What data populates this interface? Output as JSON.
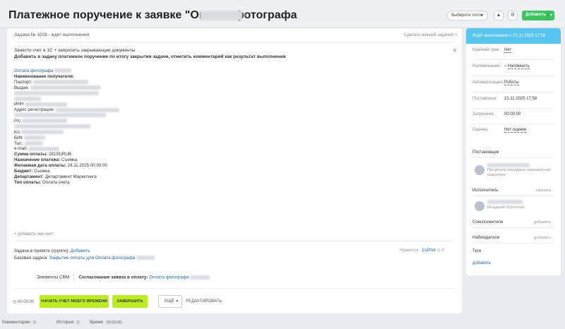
{
  "header": {
    "title": "Платежное поручение к заявке \"Оплата фотографа",
    "flow_select": "Выберите поток",
    "add_button": "Добавить"
  },
  "task": {
    "number_status": "Задача № 1028 - ждёт выполнения",
    "favorite": "Сделать важной задачей",
    "desc_line1": "Занести счет в 1С + запросить закрывающие документы",
    "desc_line2": "Добавить в задачу платежное поручение по итогу закрытия задачи, отметить комментарий как результат выполнения"
  },
  "details": {
    "link_title": "Оплата фотографа",
    "recipient_label": "Наименование получателя:",
    "passport_label": "Паспорт:",
    "issued_label": "Выдан:",
    "inn_label": "ИНН",
    "address_label": "Адрес регистрации:",
    "account_label": "Р/с",
    "corr_label": "К/с",
    "bik_label": "БИК",
    "tel_label": "Тел.:",
    "email_label": "e-mail:",
    "sum_label": "Сумма оплаты:",
    "sum_value": "28191|RUB",
    "purpose_label": "Назначение платежа:",
    "purpose_value": "Съемка",
    "date_label": "Желаемая дата оплаты:",
    "date_value": "24.11.2025 00:00:00",
    "budget_label": "Бюджет:",
    "budget_value": "Съемка",
    "department_label": "Департамент:",
    "department_value": "Департамент Маркетинга",
    "paytype_label": "Тип оплаты:",
    "paytype_value": "Оплата счета"
  },
  "checklist": "+ добавить чек-лист",
  "project": {
    "group_label": "Задача в проекте (группе):",
    "group_link": "Добавить",
    "base_label": "Базовая задача:",
    "base_link": "Закрытие оплаты для Оплата фотографа",
    "likes": "Нравится",
    "copilot": "CoPilot",
    "views": "0"
  },
  "crm": {
    "label": "Элементы CRM",
    "approval_label": "Согласование заявок в оплату:",
    "approval_link": "Оплата фотографа"
  },
  "actions": {
    "timer": "00:00:00",
    "start_time": "НАЧАТЬ УЧЕТ МОЕГО ВРЕМЕНИ",
    "finish": "ЗАВЕРШИТЬ",
    "more": "ЕЩЁ",
    "edit": "РЕДАКТИРОВАТЬ"
  },
  "sidebar": {
    "status": "Ждёт выполнения с 21.11.2025 17:58",
    "deadline_label": "Крайний срок:",
    "deadline_value": "Нет",
    "reminder_label": "Напоминание:",
    "reminder_value": "Напомнить",
    "automation_label": "Автоматизация:",
    "automation_value": "Роботы",
    "created_label": "Поставлена:",
    "created_value": "21.11.2025 17:58",
    "spent_label": "Затрачено:",
    "spent_value": "00:00:00",
    "rating_label": "Оценка:",
    "rating_value": "Нет оценки",
    "creator_label": "Постановщик",
    "creator_role": "Продюсер менеджер направление маркетинг",
    "assignee_label": "Исполнитель",
    "assignee_action": "сменить",
    "assignee_role": "Младший бухгалтер",
    "coexec_label": "Соисполнители",
    "observers_label": "Наблюдатели",
    "add_action": "добавить",
    "tags_label": "Теги",
    "tags_add": "добавить"
  },
  "tabs": {
    "comments": "Комментарии",
    "comments_count": "0",
    "history": "История",
    "history_count": "2",
    "time": "Время",
    "time_value": "00:00:00"
  },
  "colors": {
    "accent_green": "#bbed21",
    "status_blue": "#56c5f0",
    "add_button": "#3bc55f",
    "link": "#2067b0"
  }
}
